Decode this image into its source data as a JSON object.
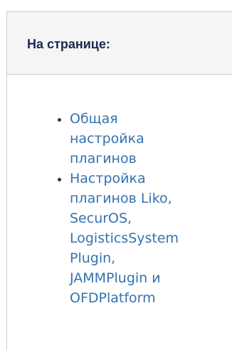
{
  "panel": {
    "title": "На странице:"
  },
  "toc": {
    "items": [
      {
        "lines": [
          "Общая",
          "настройка",
          "плагинов"
        ]
      },
      {
        "lines": [
          "Настройка",
          "плагинов Liko,",
          "SecurOS,",
          "LogisticsSystem",
          "Plugin,",
          "JAMMPlugin и",
          "OFDPlatform"
        ]
      }
    ]
  },
  "colors": {
    "link": "#3572b0",
    "title": "#172b4d",
    "header_bg": "#f5f5f5",
    "border": "#cccccc"
  }
}
